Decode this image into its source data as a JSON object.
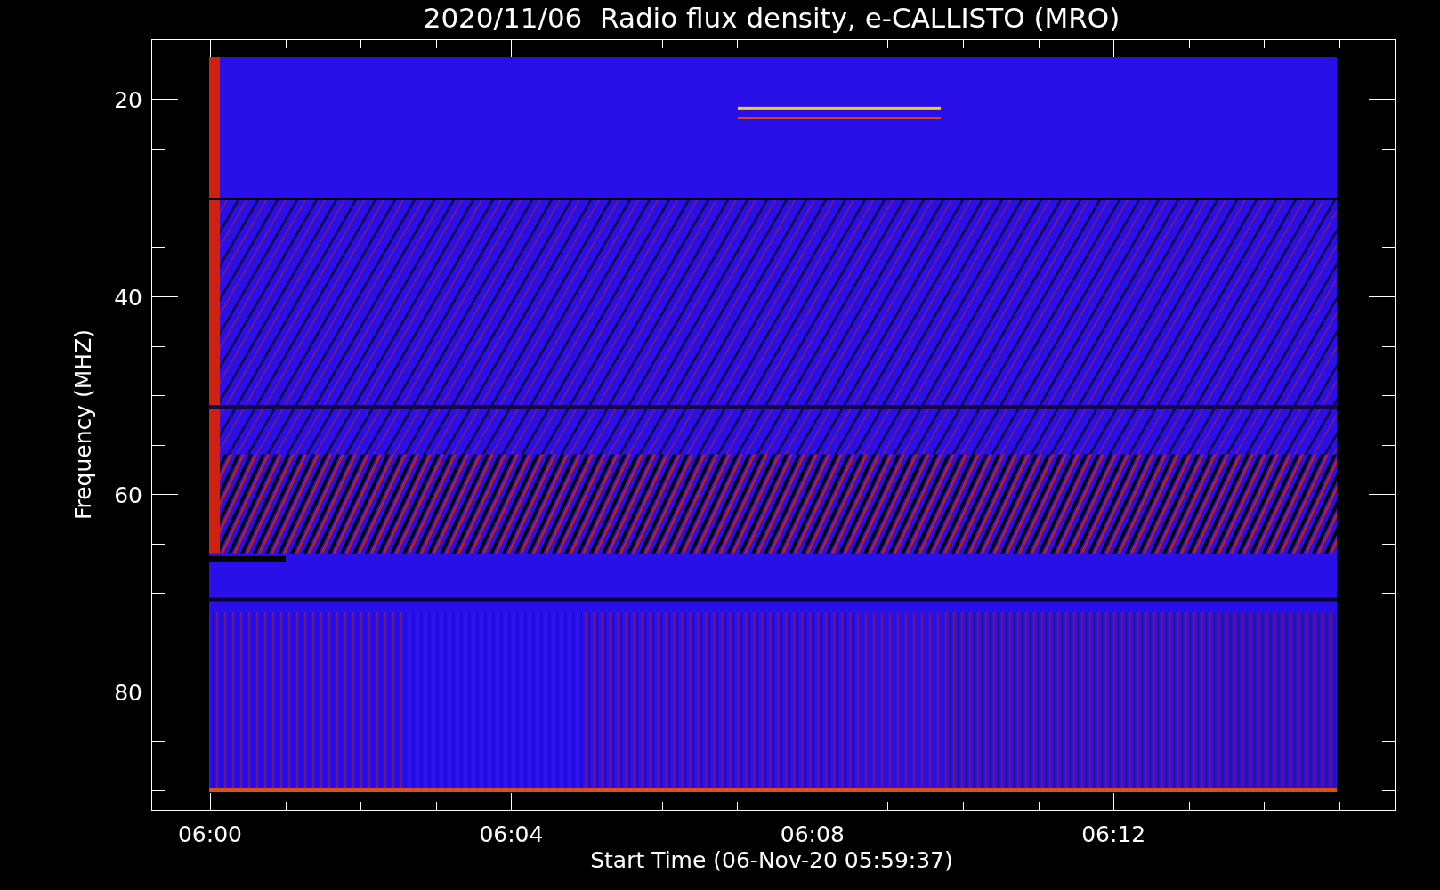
{
  "chart": {
    "title": "2020/11/06  Radio flux density, e-CALLISTO (MRO)",
    "ylabel": "Frequency (MHZ)",
    "xlabel": "Start Time (06-Nov-20 05:59:37)",
    "yticks": [
      "20",
      "40",
      "60",
      "80"
    ],
    "xticks": [
      "06:00",
      "06:04",
      "06:08",
      "06:12"
    ]
  }
}
